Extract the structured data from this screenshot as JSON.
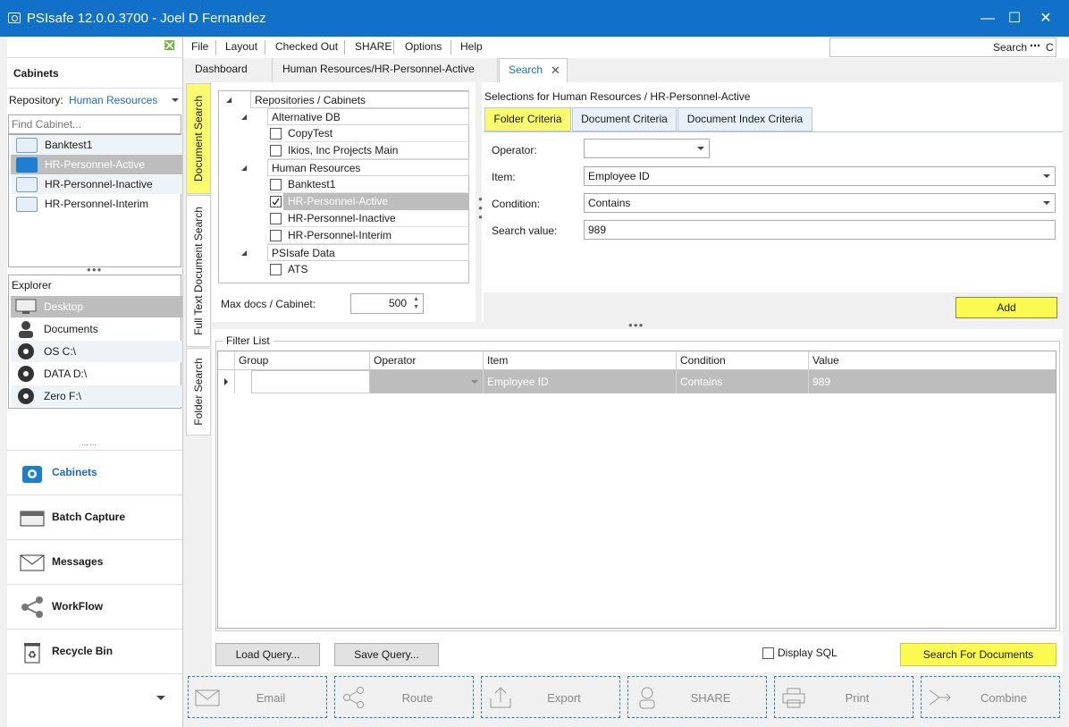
{
  "window": {
    "title": "PSIsafe 12.0.0.3700 - Joel D Fernandez"
  },
  "left": {
    "cabinets_header": "Cabinets",
    "repository_label": "Repository:",
    "repository_value": "Human Resources",
    "find_placeholder": "Find Cabinet...",
    "cabinets": [
      "Banktest1",
      "HR-Personnel-Active",
      "HR-Personnel-Inactive",
      "HR-Personnel-Interim"
    ],
    "explorer_header": "Explorer",
    "explorer_items": [
      "Desktop",
      "Documents",
      "OS C:\\",
      "DATA D:\\",
      "Zero F:\\"
    ],
    "nav": [
      "Cabinets",
      "Batch Capture",
      "Messages",
      "WorkFlow",
      "Recycle Bin"
    ]
  },
  "menu": [
    "File",
    "Layout",
    "Checked Out",
    "SHARE",
    "Options",
    "Help"
  ],
  "search_box": {
    "label": "Search",
    "suffix": "C"
  },
  "tabs": [
    "Dashboard",
    "Human Resources/HR-Personnel-Active",
    "Search"
  ],
  "vertical_tabs": [
    "Document Search",
    "Full Text Document Search",
    "Folder Search"
  ],
  "tree": {
    "header": "Repositories / Cabinets",
    "groups": [
      {
        "name": "Alternative DB",
        "items": [
          "CopyTest",
          "Ikios, Inc Projects Main"
        ]
      },
      {
        "name": "Human Resources",
        "items": [
          "Banktest1",
          "HR-Personnel-Active",
          "HR-Personnel-Inactive",
          "HR-Personnel-Interim"
        ]
      },
      {
        "name": "PSIsafe Data",
        "items": [
          "ATS"
        ]
      }
    ],
    "max_docs_label": "Max docs / Cabinet:",
    "max_docs_value": "500"
  },
  "criteria": {
    "selections_title": "Selections for Human Resources / HR-Personnel-Active",
    "tabs": [
      "Folder Criteria",
      "Document Criteria",
      "Document Index Criteria"
    ],
    "operator_label": "Operator:",
    "operator_value": "",
    "item_label": "Item:",
    "item_value": "Employee ID",
    "condition_label": "Condition:",
    "condition_value": "Contains",
    "search_value_label": "Search value:",
    "search_value": "989",
    "add_label": "Add"
  },
  "filter_list": {
    "title": "Filter List",
    "columns": [
      "Group",
      "Operator",
      "Item",
      "Condition",
      "Value"
    ],
    "rows": [
      {
        "group": "",
        "operator": "",
        "item": "Employee ID",
        "condition": "Contains",
        "value": "989"
      }
    ]
  },
  "query": {
    "load_label": "Load Query...",
    "save_label": "Save Query...",
    "display_sql_label": "Display SQL",
    "search_label": "Search For Documents"
  },
  "actions": [
    "Email",
    "Route",
    "Export",
    "SHARE",
    "Print",
    "Combine"
  ],
  "colors": {
    "titlebar": "#1171c9",
    "highlight": "#fafa6e",
    "selection": "#bdbdbd",
    "accent": "#1b6bbf"
  }
}
